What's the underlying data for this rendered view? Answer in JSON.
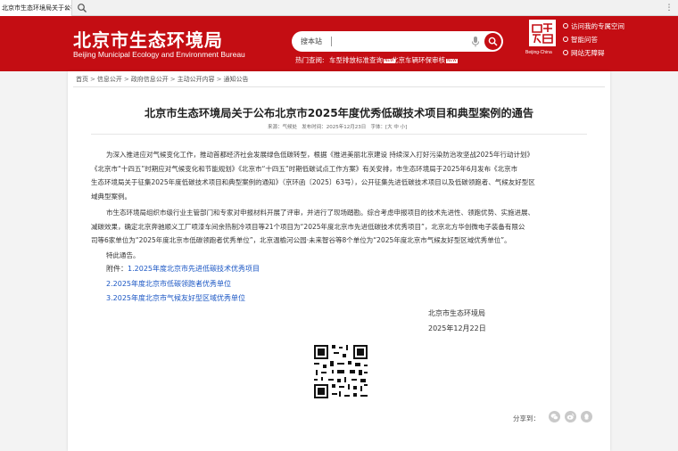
{
  "browser": {
    "tab_title": "北京市生态环境局关于公布北京...",
    "tab_close": "×",
    "menu_glyph": "⋮"
  },
  "header": {
    "site_title": "北京市生态环境局",
    "site_subtitle": "Beijing Municipal Ecology and Environment Bureau",
    "search_label": "搜本站",
    "hot_label": "热门查阅:",
    "hot_links": [
      "车型排放标准查询",
      "北京车辆环保审核"
    ],
    "new_badge": "NEW",
    "logo_caption": "Beijing-China",
    "links": [
      "访问我的专属空间",
      "智能问答",
      "网站无障碍"
    ],
    "brand_color": "#c40d13"
  },
  "breadcrumb": [
    "首页",
    "信息公开",
    "政府信息公开",
    "主动公开内容",
    "通知公告"
  ],
  "breadcrumb_sep": ">",
  "article": {
    "title": "北京市生态环境局关于公布北京市2025年度优秀低碳技术项目和典型案例的通告",
    "meta_source": "来源：气候处",
    "meta_date": "发布时间：2025年12月23日",
    "meta_font_label": "字体：",
    "meta_font_sizes": "[大 中 小]",
    "para1": [
      "为深入推进应对气候变化工作，推动首都经济社会发展绿色低碳转型，根据《推进美丽北京建设 持续深入打好污染防治攻坚战2025年行动计划》",
      "《北京市“十四五”时期应对气候变化和节能规划》《北京市“十四五”时期低碳试点工作方案》有关安排，市生态环境局于2025年6月发布《北京市",
      "生态环境局关于征集2025年度低碳技术项目和典型案例的通知》（京环函〔2025〕63号），公开征集先进低碳技术项目以及低碳领跑者、气候友好型区",
      "域典型案例。"
    ],
    "para2": [
      "市生态环境局组织市级行业主管部门和专家对申报材料开展了评审，并进行了现场踏勘。综合考虑申报项目的技术先进性、领跑优势、实施进展、",
      "减碳效果，确定北京奔驰顺义工厂喷漆车间余热制冷项目等21个项目为“2025年度北京市先进低碳技术优秀项目”，北京北方华创微电子装备有限公",
      "司等6家单位为“2025年度北京市低碳领跑者优秀单位”，北京温榆河公园·未来智谷等8个单位为“2025年度北京市气候友好型区域优秀单位”。"
    ],
    "para3": "特此通告。",
    "attach_prefix": "附件：",
    "attachments": [
      "1.2025年度北京市先进低碳技术优秀项目",
      "2.2025年度北京市低碳领跑者优秀单位",
      "3.2025年度北京市气候友好型区域优秀单位"
    ],
    "sign_org": "北京市生态环境局",
    "sign_date": "2025年12月22日"
  },
  "share": {
    "label": "分享到：",
    "icons": [
      "wechat-icon",
      "weibo-icon",
      "qq-icon"
    ]
  }
}
